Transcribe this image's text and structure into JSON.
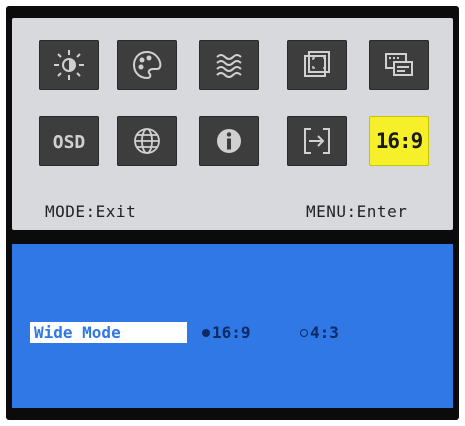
{
  "menu": {
    "tiles": [
      {
        "icon": "brightness-icon",
        "interactable": true
      },
      {
        "icon": "color-palette-icon",
        "interactable": true
      },
      {
        "icon": "wave-icon",
        "interactable": true
      },
      {
        "icon": "screen-position-icon",
        "interactable": true
      },
      {
        "icon": "picture-settings-icon",
        "interactable": true
      },
      {
        "icon": "osd-icon",
        "label": "OSD"
      },
      {
        "icon": "globe-icon"
      },
      {
        "icon": "info-icon"
      },
      {
        "icon": "input-source-icon"
      },
      {
        "icon": "aspect-ratio-icon",
        "label": "16:9",
        "selected": true
      }
    ],
    "hint_left": "MODE:Exit",
    "hint_right": "MENU:Enter",
    "selected_color": "#f6f02a"
  },
  "submenu": {
    "label": "Wide Mode",
    "options": [
      {
        "text": "16:9",
        "selected": true
      },
      {
        "text": "4:3",
        "selected": false
      }
    ],
    "background_color": "#2f78e6"
  }
}
